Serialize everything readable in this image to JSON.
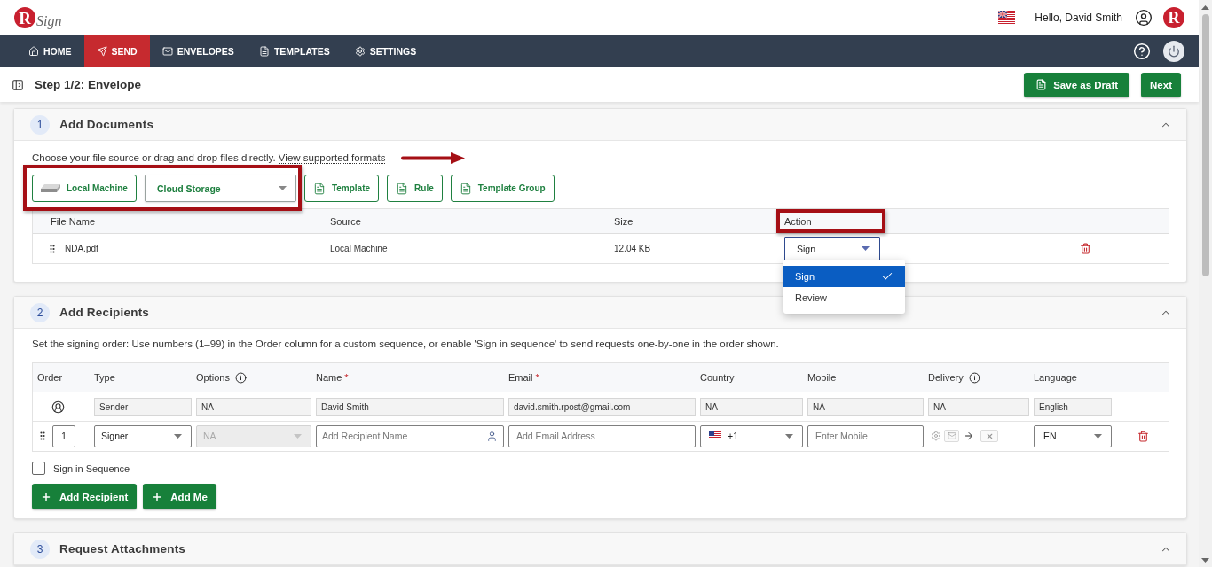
{
  "header": {
    "logo": {
      "mark": "R",
      "text": "Sign"
    },
    "greeting": "Hello, David Smith",
    "account_badge": "R"
  },
  "nav": {
    "items": [
      {
        "label": "HOME",
        "selected": false
      },
      {
        "label": "SEND",
        "selected": true
      },
      {
        "label": "ENVELOPES",
        "selected": false
      },
      {
        "label": "TEMPLATES",
        "selected": false
      },
      {
        "label": "SETTINGS",
        "selected": false
      }
    ]
  },
  "step_bar": {
    "title": "Step 1/2: Envelope",
    "buttons": [
      {
        "label": "Save as Draft",
        "kind": "draft"
      },
      {
        "label": "Next",
        "kind": "next"
      }
    ]
  },
  "sections": [
    {
      "kind": "documents",
      "number": "1",
      "title": "Add Documents",
      "expanded": true,
      "intro": "Choose your file source or drag and drop files directly.",
      "link": "View supported formats",
      "link_arrow": true,
      "sources": [
        {
          "kind": "local",
          "label": "Local Machine",
          "highlighted": true
        },
        {
          "kind": "select",
          "label": "Cloud Storage",
          "highlighted": true
        },
        {
          "kind": "doc",
          "label": "Template",
          "highlighted": false
        },
        {
          "kind": "doc",
          "label": "Rule",
          "highlighted": false
        },
        {
          "kind": "doc",
          "label": "Template Group",
          "highlighted": false
        }
      ],
      "table": {
        "columns": [
          {
            "label": "File Name",
            "highlighted": false
          },
          {
            "label": "Source",
            "highlighted": false
          },
          {
            "label": "Size",
            "highlighted": false
          },
          {
            "label": "Action",
            "highlighted": true
          }
        ],
        "rows": [
          {
            "file_name": "NDA.pdf",
            "source": "Local Machine",
            "size": "12.04 KB",
            "action": {
              "value": "Sign",
              "expanded": true,
              "options": [
                {
                  "label": "Sign",
                  "selected": true
                },
                {
                  "label": "Review",
                  "selected": false
                }
              ]
            }
          }
        ]
      }
    },
    {
      "kind": "recipients",
      "number": "2",
      "title": "Add Recipients",
      "expanded": true,
      "intro": "Set the signing order: Use numbers (1–99) in the Order column for a custom sequence, or enable 'Sign in sequence' to send requests one-by-one in the order shown.",
      "columns": [
        {
          "label": "Order",
          "info": false
        },
        {
          "label": "Type",
          "info": false
        },
        {
          "label": "Options",
          "info": true
        },
        {
          "label": "Name",
          "info": false,
          "required_mark": "*"
        },
        {
          "label": "Email",
          "info": false,
          "required_mark": "*"
        },
        {
          "label": "Country",
          "info": false
        },
        {
          "label": "Mobile",
          "info": false
        },
        {
          "label": "Delivery",
          "info": true
        },
        {
          "label": "Language",
          "info": false
        }
      ],
      "rows": [
        {
          "kind": "sender",
          "type": "Sender",
          "options": "NA",
          "name": "David Smith",
          "email": "david.smith.rpost@gmail.com",
          "country": "NA",
          "mobile": "NA",
          "delivery": "NA",
          "language": "English"
        },
        {
          "kind": "recipient",
          "order": "1",
          "type": "Signer",
          "options": "NA",
          "options_disabled": true,
          "name_placeholder": "Add Recipient Name",
          "email_placeholder": "Add Email Address",
          "country_code": "+1",
          "mobile_placeholder": "Enter Mobile",
          "language": "EN"
        }
      ],
      "sign_in_sequence": {
        "label": "Sign in Sequence",
        "checked": false
      },
      "buttons": [
        {
          "label": "Add Recipient"
        },
        {
          "label": "Add Me"
        }
      ]
    },
    {
      "kind": "attachments",
      "number": "3",
      "title": "Request Attachments",
      "expanded": true
    }
  ]
}
